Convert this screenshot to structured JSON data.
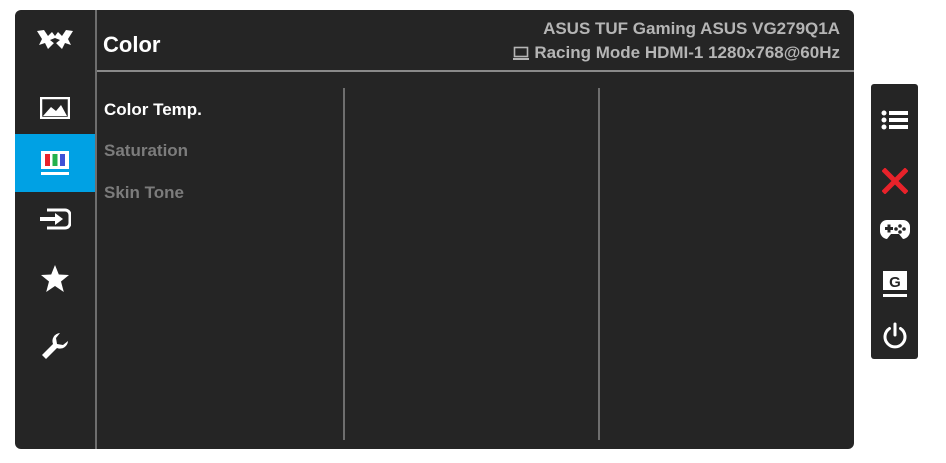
{
  "header": {
    "title": "Color",
    "model": "ASUS TUF Gaming ASUS VG279Q1A",
    "status": "Racing Mode HDMI-1 1280x768@60Hz"
  },
  "menu": {
    "items": [
      {
        "label": "Color Temp.",
        "selected": true
      },
      {
        "label": "Saturation",
        "selected": false
      },
      {
        "label": "Skin Tone",
        "selected": false
      }
    ]
  },
  "sidebar": {
    "items": [
      {
        "icon": "image-icon"
      },
      {
        "icon": "color-icon",
        "active": true
      },
      {
        "icon": "input-select-icon"
      },
      {
        "icon": "star-icon"
      },
      {
        "icon": "wrench-icon"
      }
    ]
  },
  "keys": {
    "items": [
      {
        "icon": "menu-list-icon"
      },
      {
        "icon": "close-icon"
      },
      {
        "icon": "gamepad-icon"
      },
      {
        "icon": "gameplus-g-icon"
      },
      {
        "icon": "power-icon"
      }
    ]
  },
  "colors": {
    "accent": "#00a1e4",
    "panel": "#252525",
    "close": "#e8222a",
    "color_bars": [
      "#e8222a",
      "#23b14d",
      "#3f51d6"
    ]
  }
}
